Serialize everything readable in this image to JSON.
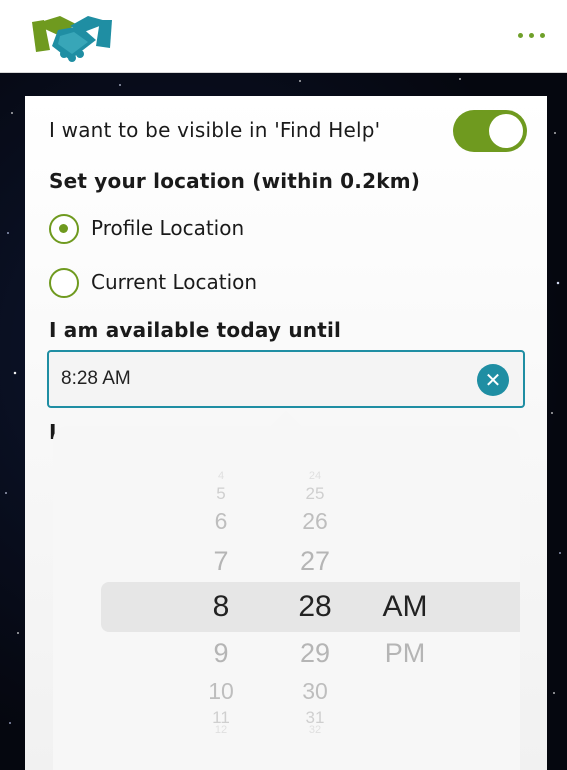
{
  "header": {
    "logo_icon": "handshake-logo",
    "menu_icon": "more-dots-icon",
    "brand_colors": {
      "green": "#6f9a1f",
      "teal": "#1f8ea3"
    }
  },
  "form": {
    "visible_label": "I want to be visible in 'Find Help'",
    "visible_toggle_on": true,
    "location_label": "Set your location (within 0.2km)",
    "location_options": [
      {
        "label": "Profile Location",
        "selected": true
      },
      {
        "label": "Current Location",
        "selected": false
      }
    ],
    "available_label": "I am available today until",
    "time_value": "8:28 AM",
    "clear_icon": "close-icon",
    "partial_label": "I"
  },
  "picker": {
    "hours": [
      "4",
      "5",
      "6",
      "7",
      "8",
      "9",
      "10",
      "11",
      "12"
    ],
    "minutes": [
      "24",
      "25",
      "26",
      "27",
      "28",
      "29",
      "30",
      "31",
      "32"
    ],
    "periods": [
      "AM",
      "PM"
    ],
    "selected_hour": "8",
    "selected_minute": "28",
    "selected_period": "AM"
  }
}
